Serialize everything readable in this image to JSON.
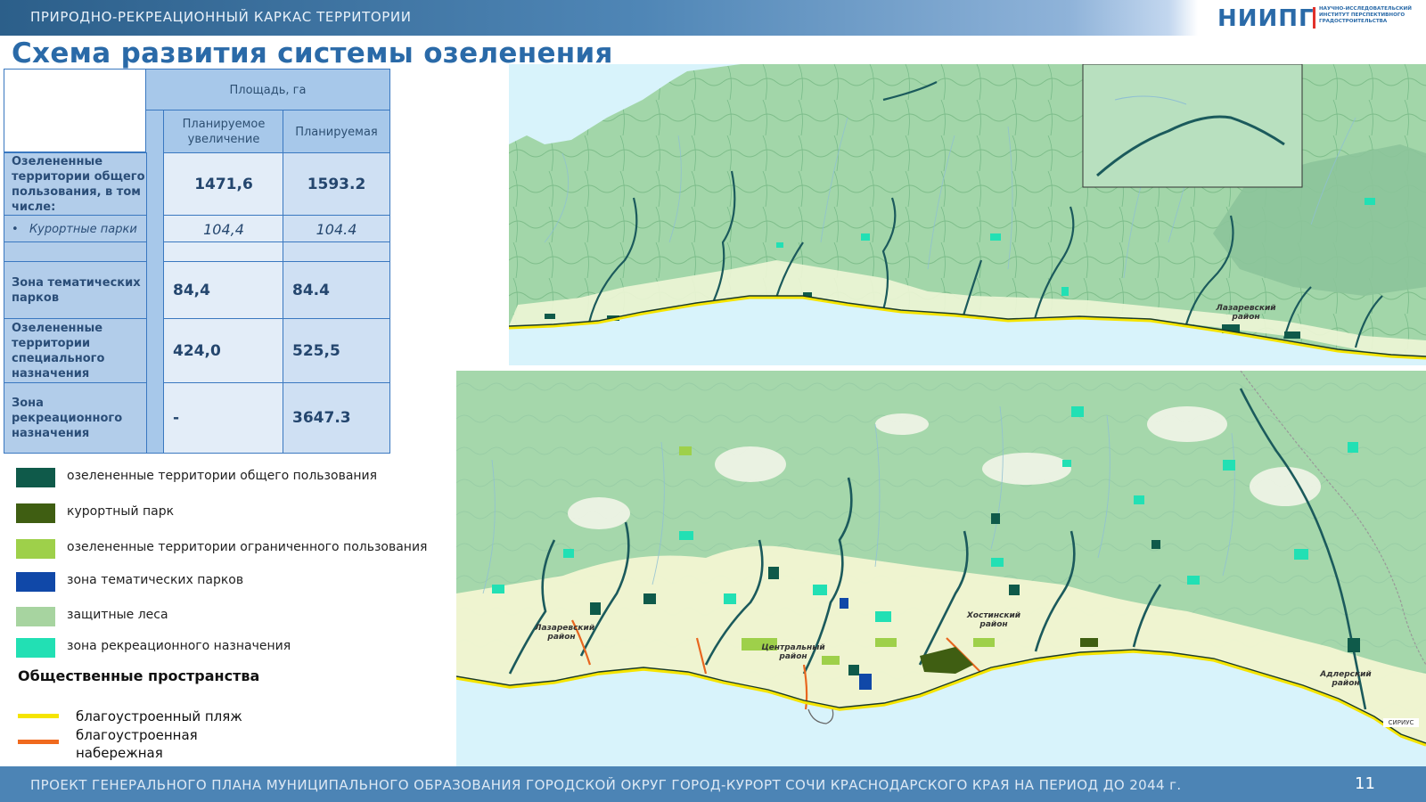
{
  "header": {
    "title": "ПРИРОДНО-РЕКРЕАЦИОННЫЙ КАРКАС ТЕРРИТОРИИ",
    "logo_main": "НИИПГ",
    "logo_sub": "НАУЧНО-ИССЛЕДОВАТЕЛЬСКИЙ ИНСТИТУТ ПЕРСПЕКТИВНОГО ГРАДОСТРОИТЕЛЬСТВА"
  },
  "page_title": "Схема развития системы озеленения",
  "table": {
    "header_group": "Площадь, га",
    "col1": "Планируемое увеличение",
    "col2": "Планируемая",
    "rows": [
      {
        "label": "Озелененные территории общего пользования, в том числе:",
        "v1": "1471,6",
        "v2": "1593.2"
      },
      {
        "label": "Курортные парки",
        "v1": "104,4",
        "v2": "104.4"
      },
      {
        "label": "",
        "v1": "",
        "v2": ""
      },
      {
        "label": "Зона тематических парков",
        "v1": "84,4",
        "v2": "84.4"
      },
      {
        "label": "Озелененные территории специального назначения",
        "v1": "424,0",
        "v2": "525,5"
      },
      {
        "label": "Зона рекреационного назначения",
        "v1": "-",
        "v2": "3647.3"
      }
    ]
  },
  "legend": {
    "items": [
      {
        "label": "озелененные территории общего пользования",
        "color": "#0f5a4a"
      },
      {
        "label": "курортный парк",
        "color": "#3f5e12"
      },
      {
        "label": "озелененные территории ограниченного пользования",
        "color": "#9ed04a"
      },
      {
        "label": "зона тематических парков",
        "color": "#1048a8"
      },
      {
        "label": "защитные леса",
        "color": "#a7d4a0"
      },
      {
        "label": "зона рекреационного назначения",
        "color": "#22e0b4"
      }
    ],
    "public_spaces_heading": "Общественные пространства",
    "lines": [
      {
        "label": "благоустроенный пляж",
        "color": "#f5e400"
      },
      {
        "label": "благоустроенная набережная",
        "color": "#f06a1e"
      }
    ]
  },
  "map_labels": {
    "lazarevsky_top": "Лазаревский район",
    "lazarevsky": "Лазаревский район",
    "central": "Центральный район",
    "khostinsky": "Хостинский район",
    "adlersky": "Адлерский район",
    "sirius": "СИРИУС"
  },
  "colors": {
    "forest": "#9fd3a8",
    "sea": "#d8f3fb",
    "urban": "#f4f7dc",
    "river": "#1b5a5c"
  },
  "footer": {
    "text": "ПРОЕКТ ГЕНЕРАЛЬНОГО ПЛАНА МУНИЦИПАЛЬНОГО ОБРАЗОВАНИЯ ГОРОДСКОЙ ОКРУГ ГОРОД-КУРОРТ СОЧИ КРАСНОДАРСКОГО КРАЯ НА ПЕРИОД ДО 2044 г.",
    "page_number": "11"
  }
}
